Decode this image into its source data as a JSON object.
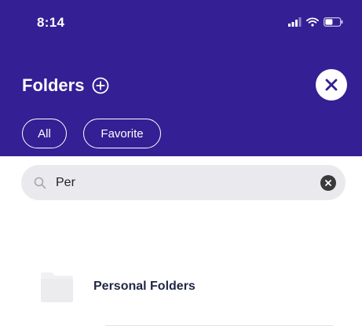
{
  "status_bar": {
    "time": "8:14",
    "icons": [
      "signal-icon",
      "wifi-icon",
      "battery-icon"
    ]
  },
  "header": {
    "title": "Folders",
    "add_icon": "plus-circle-icon",
    "close_icon": "close-icon"
  },
  "filters": [
    {
      "label": "All"
    },
    {
      "label": "Favorite"
    }
  ],
  "search": {
    "value": "Per",
    "placeholder": "",
    "icon": "search-icon",
    "clear_icon": "clear-icon"
  },
  "results": [
    {
      "label": "Personal Folders",
      "icon": "folder-icon"
    }
  ],
  "colors": {
    "header_bg": "#341f94",
    "search_bg": "#eaeaee",
    "text_dark": "#1f2747"
  }
}
